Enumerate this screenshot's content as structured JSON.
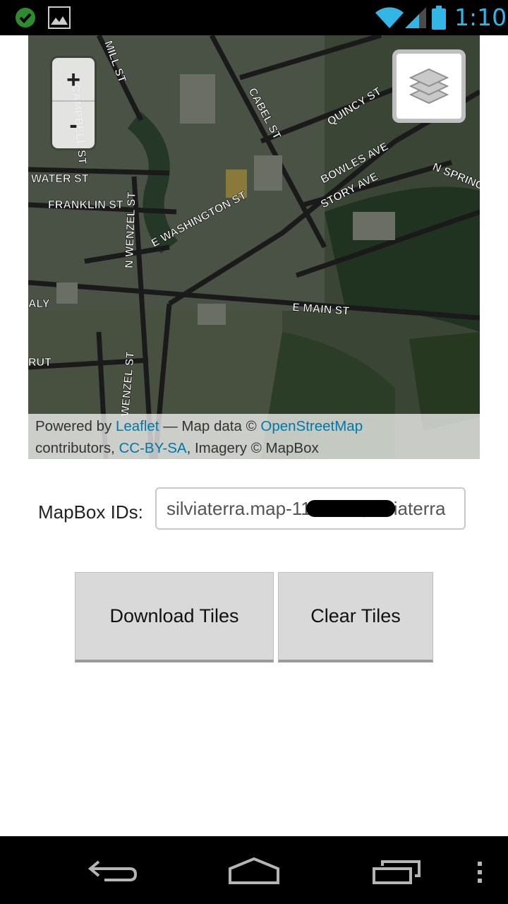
{
  "status_bar": {
    "time": "1:10",
    "icons": [
      "check-circle-icon",
      "image-icon",
      "wifi-icon",
      "signal-icon",
      "battery-icon"
    ],
    "time_color": "#33b5e5"
  },
  "map": {
    "zoom_in": "+",
    "zoom_out": "-",
    "layers_icon": "layers-icon",
    "street_labels": [
      "MILL ST",
      "CAMPBELL ST",
      "CABEL ST",
      "QUINCY ST",
      "WATER ST",
      "FRANKLIN ST",
      "N WENZEL ST",
      "E WASHINGTON ST",
      "BOWLES AVE",
      "STORY AVE",
      "N SPRING",
      "E MAIN ST",
      "WENZEL ST",
      "RUT",
      "ALY"
    ],
    "attribution": {
      "powered_by": "Powered by ",
      "leaflet": "Leaflet",
      "map_data": " — Map data © ",
      "osm": "OpenStreetMap",
      "contributors": "contributors, ",
      "license": "CC-BY-SA",
      "imagery": ", Imagery © MapBox"
    }
  },
  "form": {
    "ids_label": "MapBox IDs:",
    "ids_value": "silviaterra.map-1167307,silviaterra"
  },
  "buttons": {
    "download": "Download Tiles",
    "clear": "Clear Tiles"
  },
  "nav_bar": {
    "icons": [
      "back-icon",
      "home-icon",
      "recent-apps-icon",
      "menu-icon"
    ]
  },
  "colors": {
    "link": "#0078a8",
    "button_bg": "#d9d9d9"
  }
}
